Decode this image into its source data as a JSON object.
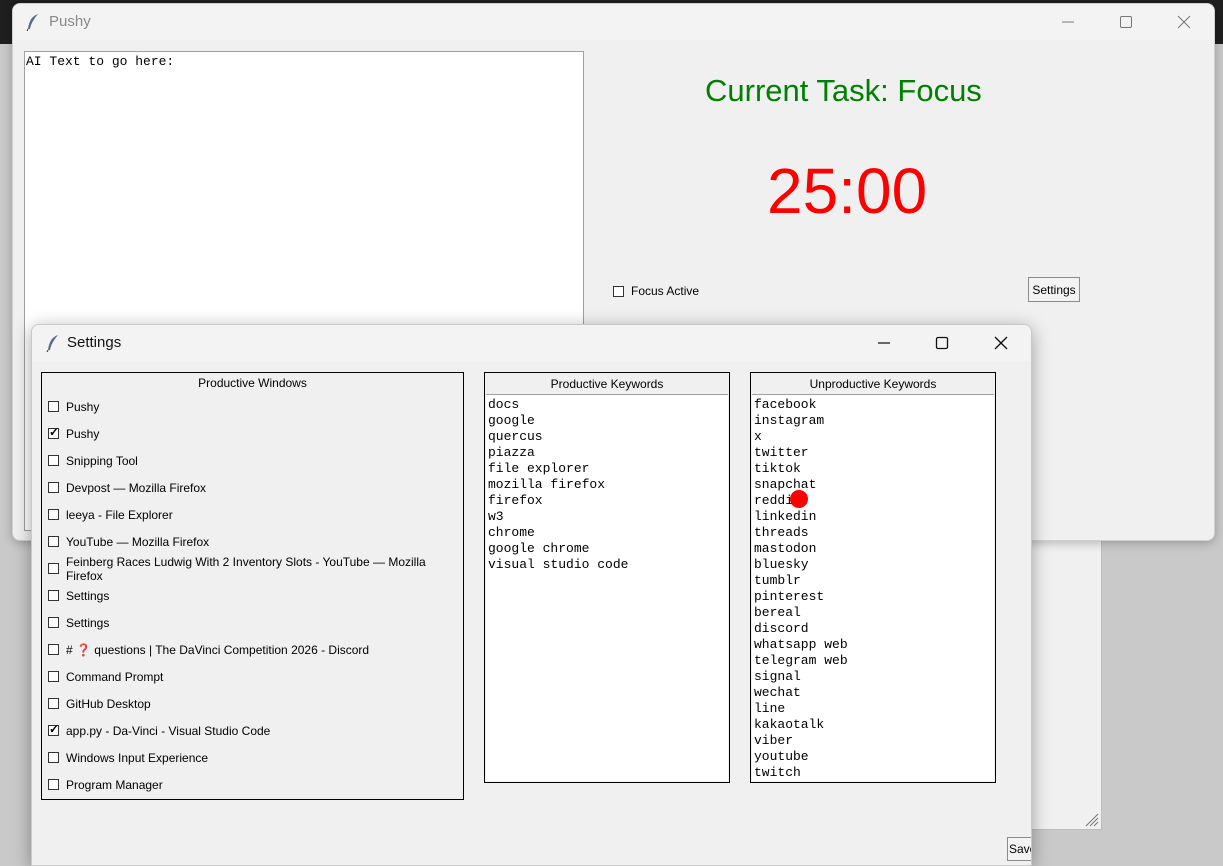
{
  "main_window": {
    "title": "Pushy",
    "ai_text": "AI Text to go here:",
    "current_task": "Current Task: Focus",
    "timer": "25:00",
    "focus_checkbox_label": "Focus Active",
    "focus_checked": false,
    "settings_button": "Settings"
  },
  "settings_window": {
    "title": "Settings",
    "productive_windows": {
      "title": "Productive Windows",
      "items": [
        {
          "label": "Pushy",
          "checked": false
        },
        {
          "label": "Pushy",
          "checked": true
        },
        {
          "label": "Snipping Tool",
          "checked": false
        },
        {
          "label": "Devpost — Mozilla Firefox",
          "checked": false
        },
        {
          "label": "leeya - File Explorer",
          "checked": false
        },
        {
          "label": "YouTube — Mozilla Firefox",
          "checked": false
        },
        {
          "label": "Feinberg Races Ludwig With 2 Inventory Slots - YouTube — Mozilla Firefox",
          "checked": false
        },
        {
          "label": "Settings",
          "checked": false
        },
        {
          "label": "Settings",
          "checked": false
        },
        {
          "label": "# ❓ questions | The DaVinci Competition 2026 - Discord",
          "checked": false
        },
        {
          "label": "Command Prompt",
          "checked": false
        },
        {
          "label": "GitHub Desktop",
          "checked": false
        },
        {
          "label": "app.py - Da-Vinci - Visual Studio Code",
          "checked": true
        },
        {
          "label": "Windows Input Experience",
          "checked": false
        },
        {
          "label": "Program Manager",
          "checked": false
        }
      ]
    },
    "productive_keywords": {
      "title": "Productive Keywords",
      "items": [
        "docs",
        "google",
        "quercus",
        "piazza",
        "file explorer",
        "mozilla firefox",
        "firefox",
        "w3",
        "chrome",
        "google chrome",
        "visual studio code"
      ]
    },
    "unproductive_keywords": {
      "title": "Unproductive Keywords",
      "items": [
        "facebook",
        "instagram",
        "x",
        "twitter",
        "tiktok",
        "snapchat",
        "reddit",
        "linkedin",
        "threads",
        "mastodon",
        "bluesky",
        "tumblr",
        "pinterest",
        "bereal",
        "discord",
        "whatsapp web",
        "telegram web",
        "signal",
        "wechat",
        "line",
        "kakaotalk",
        "viber",
        "youtube",
        "twitch"
      ]
    },
    "save_button": "Save"
  },
  "colors": {
    "task": "#008000",
    "timer": "#ff0000",
    "cursor": "#ff0000"
  }
}
